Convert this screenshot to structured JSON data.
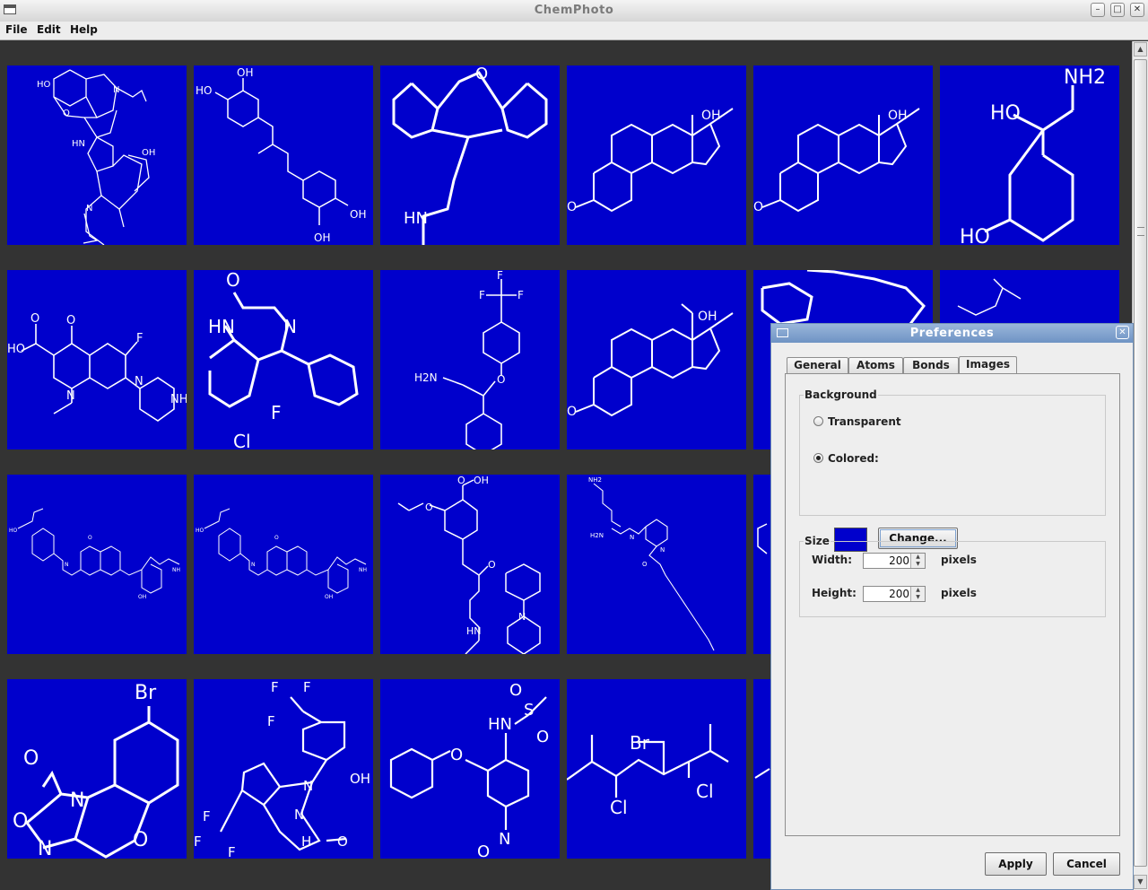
{
  "window": {
    "title": "ChemPhoto"
  },
  "menubar": {
    "items": [
      "File",
      "Edit",
      "Help"
    ]
  },
  "grid": {
    "tile_background": "#0000cc",
    "row_count_visible": 4,
    "column_count_visible": 6,
    "atom_labels": {
      "r1c1": [
        "HO",
        "O",
        "N",
        "HN",
        "OH",
        "N"
      ],
      "r1c2": [
        "OH",
        "HO",
        "OH",
        "OH"
      ],
      "r1c3": [
        "O",
        "HN"
      ],
      "r1c4": [
        "OH",
        "O"
      ],
      "r1c5": [
        "OH",
        "O"
      ],
      "r1c6": [
        "NH2",
        "HO",
        "HO"
      ],
      "r2c1": [
        "HO",
        "O",
        "O",
        "F",
        "N",
        "N",
        "NH"
      ],
      "r2c2": [
        "O",
        "HN",
        "N",
        "F",
        "Cl"
      ],
      "r2c3": [
        "F",
        "F",
        "F",
        "O",
        "H2N"
      ],
      "r2c4": [
        "OH",
        "O"
      ],
      "r3c3": [
        "O",
        "OH",
        "O",
        "O",
        "HN",
        "N"
      ],
      "r3c4": [
        "NH2",
        "H2N",
        "N",
        "O",
        "N"
      ],
      "r4c1": [
        "Br",
        "O",
        "N",
        "O",
        "N",
        "O"
      ],
      "r4c2": [
        "F",
        "F",
        "F",
        "N",
        "OH",
        "O",
        "N",
        "H",
        "F",
        "F",
        "F"
      ],
      "r4c3": [
        "O",
        "S",
        "O",
        "HN",
        "O",
        "N",
        "O"
      ],
      "r4c4": [
        "Br",
        "Cl",
        "Cl"
      ]
    }
  },
  "dialog": {
    "title": "Preferences",
    "tabs": [
      "General",
      "Atoms",
      "Bonds",
      "Images"
    ],
    "active_tab": "Images",
    "background": {
      "group_label": "Background",
      "transparent_label": "Transparent",
      "colored_label": "Colored:",
      "selected": "Colored",
      "color": "#0000cc",
      "change_button": "Change..."
    },
    "size": {
      "group_label": "Size",
      "width_label": "Width:",
      "width_value": "200",
      "height_label": "Height:",
      "height_value": "200",
      "unit": "pixels"
    },
    "buttons": {
      "apply": "Apply",
      "cancel": "Cancel"
    }
  }
}
